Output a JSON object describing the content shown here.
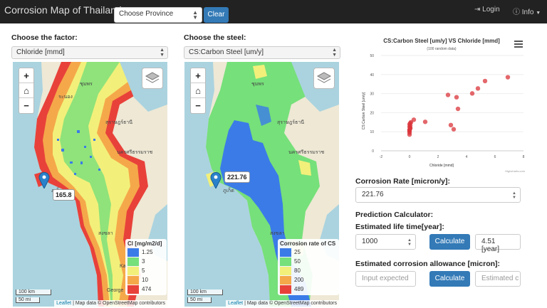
{
  "navbar": {
    "title": "Corrosion Map of Thailand",
    "province_placeholder": "Choose Province",
    "clear_label": "Clear",
    "login_label": "Login",
    "info_label": "Info"
  },
  "factor": {
    "label": "Choose the factor:",
    "selected": "Chloride [mmd]"
  },
  "steel": {
    "label": "Choose the steel:",
    "selected": "CS:Carbon Steel [um/y]"
  },
  "map_common": {
    "scale_km": "100 km",
    "scale_mi": "50 mi",
    "attribution_leaflet": "Leaflet",
    "attribution_text": "| Map data © OpenStreetMap contributors"
  },
  "map_left": {
    "marker_value": "165.8",
    "legend_title": "Cl [mg/m2/d]",
    "legend": [
      {
        "label": "1.25",
        "color": "#3b7be8"
      },
      {
        "label": "3",
        "color": "#76e07a"
      },
      {
        "label": "5",
        "color": "#f2f07a"
      },
      {
        "label": "10",
        "color": "#f5a84a"
      },
      {
        "label": "474",
        "color": "#e8413a"
      }
    ],
    "place_labels": [
      "ชุมพร",
      "ระนอง",
      "สุราษฎร์ธานี",
      "นครศรีธรรมราช",
      "ภูเก็ต",
      "สงขลา",
      "Kang",
      "George"
    ]
  },
  "map_right": {
    "marker_value": "221.76",
    "legend_title": "Corrosion rate of CS",
    "legend": [
      {
        "label": "25",
        "color": "#3b7be8"
      },
      {
        "label": "50",
        "color": "#76e07a"
      },
      {
        "label": "80",
        "color": "#f2f07a"
      },
      {
        "label": "200",
        "color": "#f5a84a"
      },
      {
        "label": "489",
        "color": "#e8413a"
      }
    ],
    "place_labels": [
      "ชุมพร",
      "สุราษฎร์ธานี",
      "นครศรีธรรมราช",
      "ภูเก็ต",
      "สงขลา"
    ]
  },
  "chart_data": {
    "type": "scatter",
    "title": "CS:Carbon Steel [um/y] VS Chloride [mmd]",
    "subtitle": "(100 random data)",
    "xlabel": "Chloride [mmd]",
    "ylabel": "CS:Carbon Steel [um/y]",
    "xlim": [
      -2,
      8
    ],
    "ylim": [
      0,
      50
    ],
    "xticks": [
      "-2",
      "0",
      "2",
      "4",
      "6",
      "8"
    ],
    "yticks": [
      "0",
      "10",
      "20",
      "30",
      "40",
      "50"
    ],
    "credit": "Highcharts.com",
    "point_color": "#d9343a",
    "points": [
      [
        0.0,
        8.5
      ],
      [
        0.0,
        9.5
      ],
      [
        0.0,
        10.3
      ],
      [
        0.0,
        11.0
      ],
      [
        0.05,
        11.8
      ],
      [
        0.0,
        12.5
      ],
      [
        0.05,
        13.2
      ],
      [
        0.0,
        13.9
      ],
      [
        0.05,
        14.5
      ],
      [
        0.1,
        15.0
      ],
      [
        0.3,
        16.3
      ],
      [
        1.1,
        15.2
      ],
      [
        0.0,
        10.8
      ],
      [
        0.05,
        12.0
      ],
      [
        2.7,
        29.3
      ],
      [
        3.3,
        28.1
      ],
      [
        3.4,
        22.0
      ],
      [
        4.4,
        30.1
      ],
      [
        4.8,
        32.7
      ],
      [
        5.3,
        36.6
      ],
      [
        6.9,
        38.6
      ],
      [
        2.9,
        13.5
      ],
      [
        3.1,
        11.3
      ]
    ],
    "menu_icon": "hamburger-icon"
  },
  "form": {
    "corrosion_rate_label": "Corrosion Rate [micron/y]:",
    "corrosion_rate_value": "221.76",
    "prediction_label": "Prediction Calculator:",
    "life_label": "Estimated life time[year]:",
    "life_value": "1000",
    "calc_label": "Calculate",
    "life_result": "4.51 [year]",
    "allowance_label": "Estimated corrosion allowance [micron]:",
    "allowance_placeholder": "Input expected",
    "allowance_result_placeholder": "Estimated c"
  }
}
